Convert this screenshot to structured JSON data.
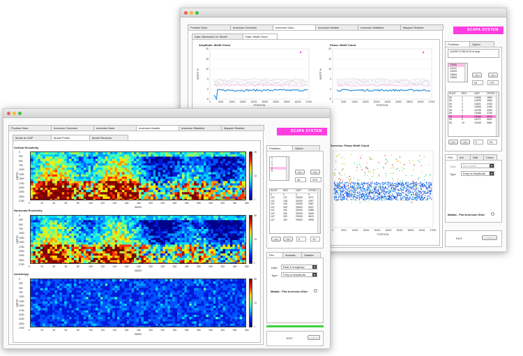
{
  "back": {
    "tabs": [
      "Position Data",
      "Inversion Overview",
      "Inversion Data",
      "Inversion Models",
      "Inversion Statistics",
      "Mapped Statistic"
    ],
    "active_tab": 2,
    "subtabs": [
      "Data: Measured vs. Model",
      "Data: Misfit Cloud"
    ],
    "logo": "SCAPA SYSTEM",
    "panel_tabs": [
      "Positions",
      "Option"
    ],
    "file_label": "1425071750112X.6.resp",
    "positions_list": [
      "13646",
      "13121",
      "13429",
      "13664",
      "13608"
    ],
    "position_value": "54",
    "position_total": "170",
    "table_header": [
      "SHOT",
      "REC",
      "CMP",
      "OFFSE"
    ],
    "table_rows": [
      [
        "55",
        "1",
        "14366",
        "1854"
      ],
      [
        "55",
        "2",
        "14096",
        "1660"
      ],
      [
        "55",
        "3",
        "14621",
        "2030"
      ],
      [
        "55",
        "4",
        "13646",
        "2180"
      ],
      [
        "55",
        "5",
        "13756",
        "2490"
      ],
      [
        "55",
        "7",
        "13466",
        "2780"
      ],
      [
        "55",
        "8",
        "13466",
        "3030"
      ],
      [
        "55",
        "9",
        "13271",
        "3541"
      ],
      [
        "55",
        "10",
        "13156",
        "3681"
      ]
    ],
    "selected_row": 6,
    "nav_value": "0",
    "nav_total": "24",
    "plot_tabs": [
      "Plot",
      "Ani",
      "Stat",
      "Cloud"
    ],
    "data_label": "Data",
    "data_value": "As Loaded",
    "type_label": "Type",
    "type_value": "Freq vs Amplitude",
    "matlab_label": "Matlab - Plot Inversion Slice",
    "exit_label": "EXIT",
    "chart1_title": "Amplitude: Misfit Cloud",
    "chart2_title": "Phase: Misfit Cloud",
    "chart3_title": "Overview: Phase Misfit Cloud",
    "chart_ylabel": "MISFIT %",
    "chart_xlabel": "POSITION",
    "y_ticks": [
      "20",
      "15",
      "10",
      "5",
      "0",
      "-5"
    ],
    "x_ticks": [
      "0",
      "5000",
      "10000",
      "15000",
      "20000",
      "25000",
      "30000",
      "35000",
      "40000",
      "47000"
    ]
  },
  "front": {
    "tabs": [
      "Position Data",
      "Inversion Overview",
      "Inversion Data",
      "Inversion Models",
      "Inversion Statistics",
      "Mapped Statistic"
    ],
    "active_tab": 3,
    "subtabs": [
      "Model at CMP",
      "Model Profile",
      "Model Structure"
    ],
    "active_subtab": 1,
    "logo": "SCAPA SYSTEM",
    "heat_titles": [
      "Vertical Resistivity",
      "Horizontal Resistivity",
      "Anisotropy"
    ],
    "depth_label": "DEPTH",
    "index_label": "INDEX",
    "depth_ticks": [
      "0",
      "250",
      "500",
      "750",
      "1000",
      "1250",
      "1500",
      "1750",
      "2000",
      "2250",
      "2500",
      "2750"
    ],
    "index_ticks": [
      "0",
      "20",
      "40",
      "60",
      "80",
      "100",
      "120",
      "140",
      "160",
      "180",
      "200",
      "220",
      "240",
      "260",
      "280",
      "300",
      "320",
      "340",
      "360"
    ],
    "cbar_ticks": [
      "25",
      "13",
      "1"
    ],
    "panel_tabs": [
      "Positions",
      "Option"
    ],
    "positions_list": [
      "1",
      "2",
      "3",
      "4",
      "5"
    ],
    "selected_position": 3,
    "position_value": "46",
    "position_total": "378",
    "table_header": [
      "SHOT",
      "REC",
      "CMP",
      "OFFSE"
    ],
    "table_rows": [
      [
        "0",
        "0",
        "0",
        "0"
      ],
      [
        "147",
        "147",
        "25200",
        "1571"
      ],
      [
        "147",
        "148",
        "25200",
        "1997"
      ],
      [
        "147",
        "149",
        "25400",
        "2087"
      ],
      [
        "147",
        "150",
        "25000",
        "3047"
      ],
      [
        "147",
        "151",
        "25200",
        "3486"
      ],
      [
        "147",
        "152",
        "25200",
        "3949"
      ],
      [
        "147",
        "153",
        "25400",
        "4623"
      ],
      [
        "147",
        "154",
        "25000",
        "4998"
      ]
    ],
    "nav_value": "0",
    "nav_total": "13",
    "plot_tabs": [
      "Plot",
      "Animate",
      "Statistic"
    ],
    "data_label": "Data",
    "data_value": "Real & Imaginary",
    "type_label": "Type",
    "type_value": "Freq vs Amplitude",
    "matlab_label": "Matlab - Plot Inversion Slice",
    "exit_label": "EXIT",
    "prev_label": "<<",
    "next_label": ">>"
  },
  "colors": {
    "accent": "#ff3de0",
    "selection": "#ff86d6",
    "progress": "#3cd33c"
  }
}
